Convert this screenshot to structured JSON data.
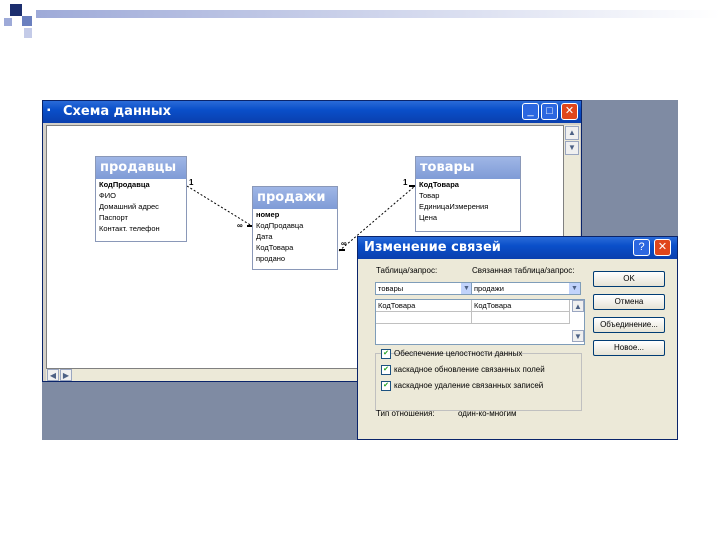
{
  "window": {
    "title": "Схема данных"
  },
  "tables": [
    {
      "name": "продавцы",
      "fields": [
        "КодПродавца",
        "ФИО",
        "Домашний адрес",
        "Паспорт",
        "Контакт. телефон"
      ]
    },
    {
      "name": "продажи",
      "fields": [
        "номер",
        "КодПродавца",
        "Дата",
        "КодТовара",
        "продано"
      ]
    },
    {
      "name": "товары",
      "fields": [
        "КодТовара",
        "Товар",
        "ЕдиницаИзмерения",
        "Цена"
      ]
    }
  ],
  "relations": [
    {
      "one": "1",
      "many": "∞"
    },
    {
      "one": "1",
      "many": "∞"
    }
  ],
  "dialog": {
    "title": "Изменение связей",
    "table_label": "Таблица/запрос:",
    "related_label": "Связанная таблица/запрос:",
    "table_value": "товары",
    "related_value": "продажи",
    "field_left": "КодТовара",
    "field_right": "КодТовара",
    "check1": "Обеспечение целостности данных",
    "check2": "каскадное обновление связанных полей",
    "check3": "каскадное удаление связанных записей",
    "type_label": "Тип отношения:",
    "type_value": "один-ко-многим",
    "buttons": [
      "OK",
      "Отмена",
      "Объединение...",
      "Новое..."
    ],
    "help": "?",
    "close": "✕"
  },
  "colors": {
    "titlebar": "#0a4fc9",
    "table_header": "#8aa4dc",
    "background": "#7f8ba3"
  }
}
